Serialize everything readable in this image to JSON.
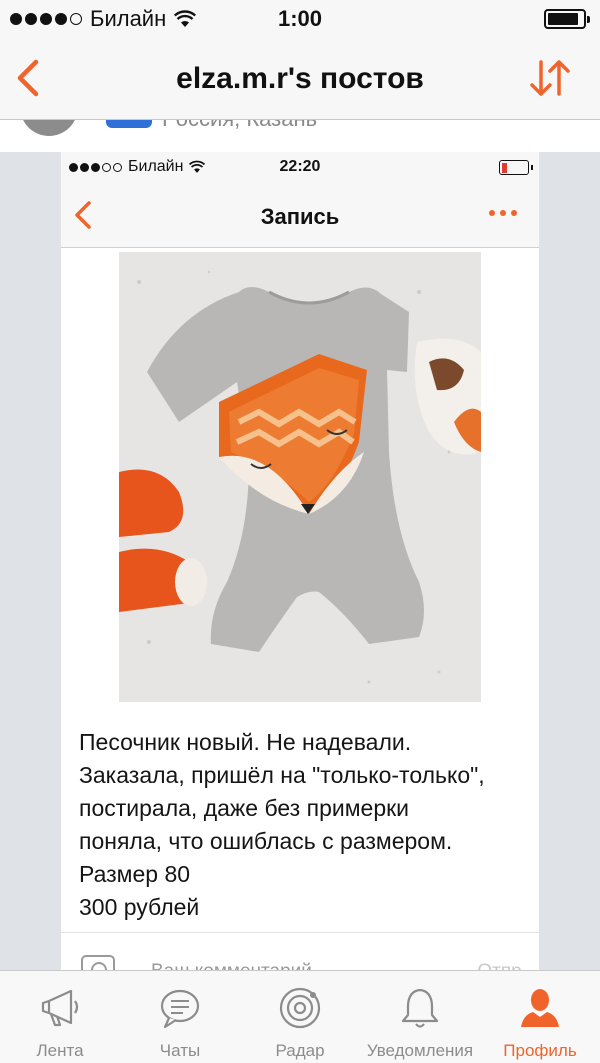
{
  "status_bar": {
    "carrier": "Билайн",
    "time": "1:00"
  },
  "nav": {
    "title": "elza.m.r's постов",
    "back_icon": "chevron-left-icon",
    "sort_icon": "sort-arrows-icon"
  },
  "profile_peek": {
    "location": "Россия, Казань"
  },
  "post_screenshot": {
    "status_bar": {
      "carrier": "Билайн",
      "time": "22:20"
    },
    "nav": {
      "title": "Запись"
    },
    "text": "Песочник новый. Не надевали.\nЗаказала, пришёл на \"только-только\",\nпостирала, даже без примерки\nпоняла, что ошиблась с размером.\nРазмер 80\n300 рублей",
    "comment_placeholder": "Ваш комментарий",
    "comment_send": "Отпр."
  },
  "tabs": [
    {
      "label": "Лента",
      "icon": "megaphone-icon",
      "active": false
    },
    {
      "label": "Чаты",
      "icon": "chat-bubble-icon",
      "active": false
    },
    {
      "label": "Радар",
      "icon": "radar-icon",
      "active": false
    },
    {
      "label": "Уведомления",
      "icon": "bell-icon",
      "active": false
    },
    {
      "label": "Профиль",
      "icon": "profile-icon",
      "active": true
    }
  ],
  "colors": {
    "accent": "#f0642c",
    "inactive_tab": "#8c8c8c",
    "background": "#dfe3e7"
  }
}
